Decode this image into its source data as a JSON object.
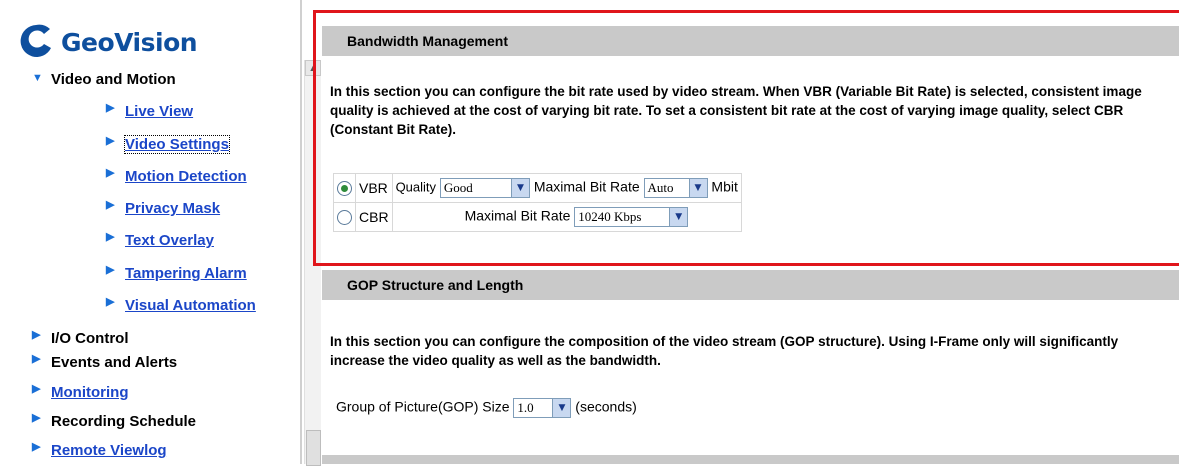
{
  "app": {
    "logo_text": "GeoVision"
  },
  "sidebar": {
    "section": "Video and Motion",
    "sub_items": [
      {
        "label": "Live View"
      },
      {
        "label": "Video Settings"
      },
      {
        "label": "Motion Detection"
      },
      {
        "label": "Privacy Mask"
      },
      {
        "label": "Text Overlay"
      },
      {
        "label": "Tampering Alarm"
      },
      {
        "label": "Visual Automation"
      }
    ],
    "items": [
      {
        "label": "I/O Control"
      },
      {
        "label": "Events and Alerts"
      },
      {
        "label": "Monitoring"
      },
      {
        "label": "Recording Schedule"
      },
      {
        "label": "Remote Viewlog"
      }
    ]
  },
  "bandwidth": {
    "title": "Bandwidth Management",
    "description": "In this section you can configure the bit rate used by video stream. When VBR (Variable Bit Rate) is selected, consistent image quality is achieved at the cost of varying bit rate. To set a consistent bit rate at the cost of varying image quality, select CBR (Constant Bit Rate).",
    "vbr": {
      "label": "VBR",
      "selected": true,
      "quality_label": "Quality",
      "quality_value": "Good",
      "max_label": "Maximal Bit Rate",
      "max_value": "Auto",
      "unit": "Mbit"
    },
    "cbr": {
      "label": "CBR",
      "selected": false,
      "max_label": "Maximal Bit Rate",
      "max_value": "10240 Kbps"
    }
  },
  "gop": {
    "title": "GOP Structure and Length",
    "description": "In this section you can configure the composition of the video stream (GOP structure). Using I-Frame only will significantly increase the video quality as well as the bandwidth.",
    "size_label": "Group of Picture(GOP) Size",
    "size_value": "1.0",
    "unit": "(seconds)"
  },
  "colors": {
    "highlight": "#e0151b",
    "link": "#1b46c8",
    "section_bg": "#c9c9c9"
  }
}
